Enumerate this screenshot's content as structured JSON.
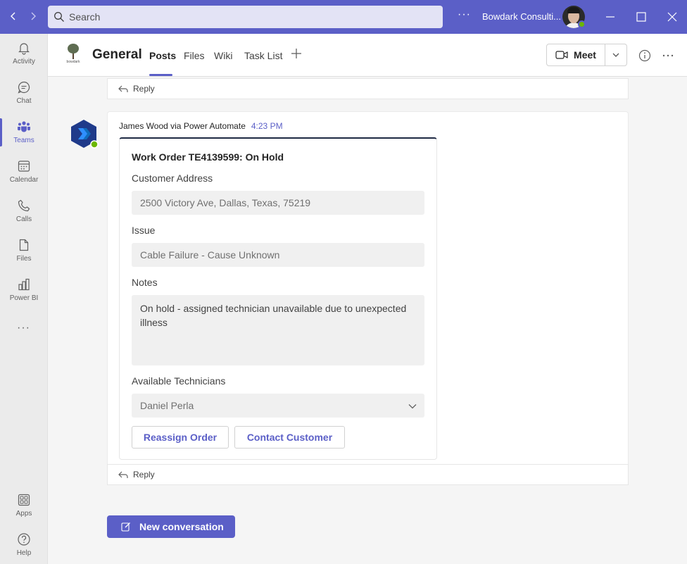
{
  "titlebar": {
    "search_placeholder": "Search",
    "org_name": "Bowdark Consulti...",
    "more": "···"
  },
  "rail": {
    "items": [
      {
        "label": "Activity",
        "icon": "bell-icon"
      },
      {
        "label": "Chat",
        "icon": "chat-icon"
      },
      {
        "label": "Teams",
        "icon": "teams-icon"
      },
      {
        "label": "Calendar",
        "icon": "calendar-icon"
      },
      {
        "label": "Calls",
        "icon": "phone-icon"
      },
      {
        "label": "Files",
        "icon": "file-icon"
      },
      {
        "label": "Power BI",
        "icon": "powerbi-icon"
      },
      {
        "label": "Apps",
        "icon": "apps-icon"
      },
      {
        "label": "Help",
        "icon": "help-icon"
      }
    ],
    "more": "···",
    "active": "Teams"
  },
  "header": {
    "team_logo_text": "bowdark",
    "channel_name": "General",
    "tabs": [
      {
        "label": "Posts",
        "active": true
      },
      {
        "label": "Files",
        "active": false
      },
      {
        "label": "Wiki",
        "active": false
      },
      {
        "label": "Task List",
        "active": false
      }
    ],
    "meet_label": "Meet"
  },
  "thread": {
    "reply_label": "Reply"
  },
  "post": {
    "author": "James Wood via Power Automate",
    "time": "4:23 PM",
    "card": {
      "title": "Work Order TE4139599: On Hold",
      "address_label": "Customer Address",
      "address_value": "2500 Victory Ave, Dallas, Texas, 75219",
      "issue_label": "Issue",
      "issue_value": "Cable Failure - Cause Unknown",
      "notes_label": "Notes",
      "notes_value": "On hold - assigned technician unavailable due to unexpected illness",
      "technicians_label": "Available Technicians",
      "technicians_selected": "Daniel Perla",
      "reassign_label": "Reassign Order",
      "contact_label": "Contact Customer"
    },
    "reply_label": "Reply"
  },
  "new_conversation_label": "New conversation",
  "colors": {
    "brand": "#5b5fc7",
    "presence_available": "#6bb700"
  }
}
